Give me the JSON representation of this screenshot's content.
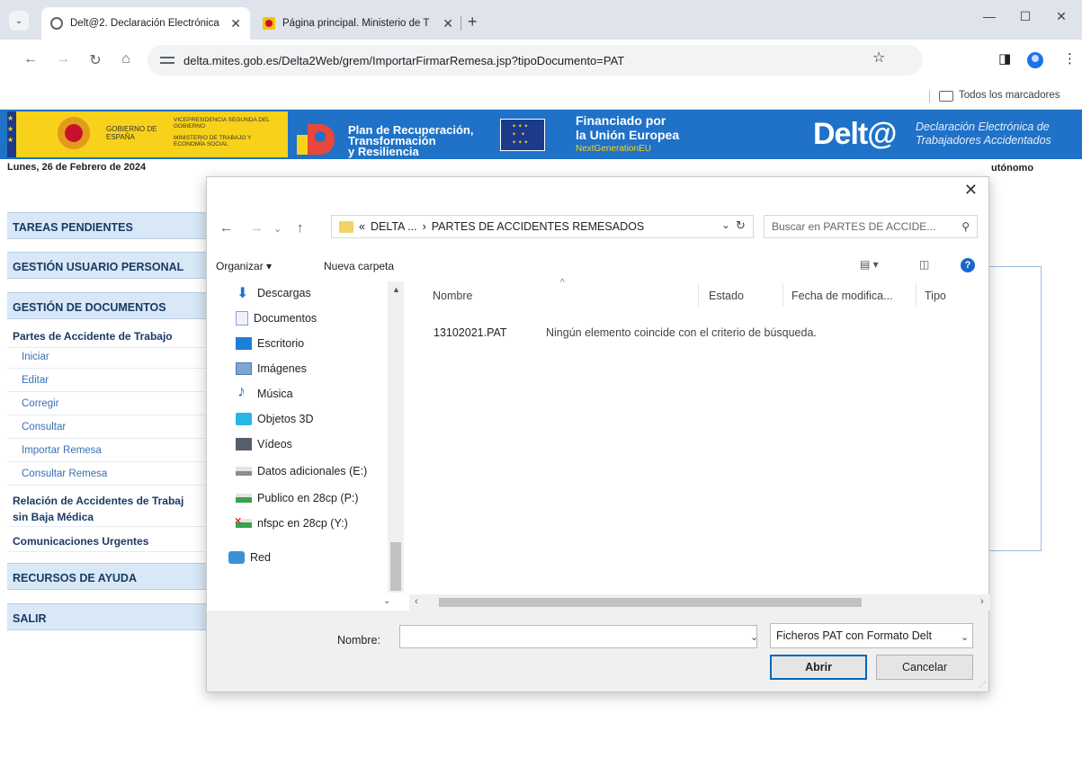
{
  "browser": {
    "tabs": [
      {
        "title": "Delt@2. Declaración Electrónica",
        "close": "✕"
      },
      {
        "title": "Página principal. Ministerio de T",
        "close": "✕"
      }
    ],
    "new_tab": "+",
    "tab_dropdown": "⌄",
    "url": "delta.mites.gob.es/Delta2Web/grem/ImportarFirmarRemesa.jsp?tipoDocumento=PAT",
    "bookmarks_label": "Todos los marcadores",
    "window_controls": {
      "minimize": "—",
      "maximize": "☐",
      "close": "✕"
    }
  },
  "banner": {
    "gobierno": "GOBIERNO DE ESPAÑA",
    "vicepresidencia": "VICEPRESIDENCIA SEGUNDA DEL GOBIERNO",
    "ministerio": "MINISTERIO DE TRABAJO Y ECONOMÍA SOCIAL",
    "plan_line1": "Plan de Recuperación,",
    "plan_line2": "Transformación",
    "plan_line3": "y Resiliencia",
    "eu_line1": "Financiado por",
    "eu_line2": "la Unión Europea",
    "eu_line3": "NextGenerationEU",
    "delta_logo": "Delt@",
    "delta_sub1": "Declaración Electrónica de",
    "delta_sub2": "Trabajadores Accidentados"
  },
  "page": {
    "date": "Lunes, 26 de Febrero de 2024",
    "autonomo": "utónomo"
  },
  "menu": {
    "tareas": "TAREAS PENDIENTES",
    "gestion_usuario": "GESTIÓN USUARIO PERSONAL",
    "gestion_docs": "GESTIÓN DE DOCUMENTOS",
    "partes": "Partes de Accidente de Trabajo",
    "sub_items": [
      "Iniciar",
      "Editar",
      "Corregir",
      "Consultar",
      "Importar Remesa",
      "Consultar Remesa"
    ],
    "relacion_1": "Relación de Accidentes de Trabaj",
    "relacion_2": "sin Baja Médica",
    "comunicaciones": "Comunicaciones Urgentes",
    "recursos": "RECURSOS DE AYUDA",
    "salir": "SALIR"
  },
  "dialog": {
    "close": "✕",
    "breadcrumb_prefix": "«",
    "breadcrumb_1": "DELTA ...",
    "breadcrumb_sep": "›",
    "breadcrumb_2": "PARTES DE ACCIDENTES REMESADOS",
    "search_placeholder": "Buscar en PARTES DE ACCIDE...",
    "organizar": "Organizar ▾",
    "nueva_carpeta": "Nueva carpeta",
    "nav_items": [
      "Descargas",
      "Documentos",
      "Escritorio",
      "Imágenes",
      "Música",
      "Objetos 3D",
      "Vídeos",
      "Datos adicionales (E:)",
      "Publico en 28cp (P:)",
      "nfspc en 28cp (Y:)",
      "Red"
    ],
    "columns": {
      "nombre": "Nombre",
      "estado": "Estado",
      "fecha": "Fecha de modifica...",
      "tipo": "Tipo"
    },
    "file_name": "13102021.PAT",
    "empty_message": "Ningún elemento coincide con el criterio de búsqueda.",
    "filename_label": "Nombre:",
    "filename_value": "",
    "filter": "Ficheros PAT con Formato Delt",
    "open_button": "Abrir",
    "cancel_button": "Cancelar"
  },
  "colors": {
    "banner_blue": "#1f72c7",
    "gov_yellow": "#f8d21a",
    "menu_header": "#d8e8f7",
    "primary_button_border": "#0067c0"
  }
}
